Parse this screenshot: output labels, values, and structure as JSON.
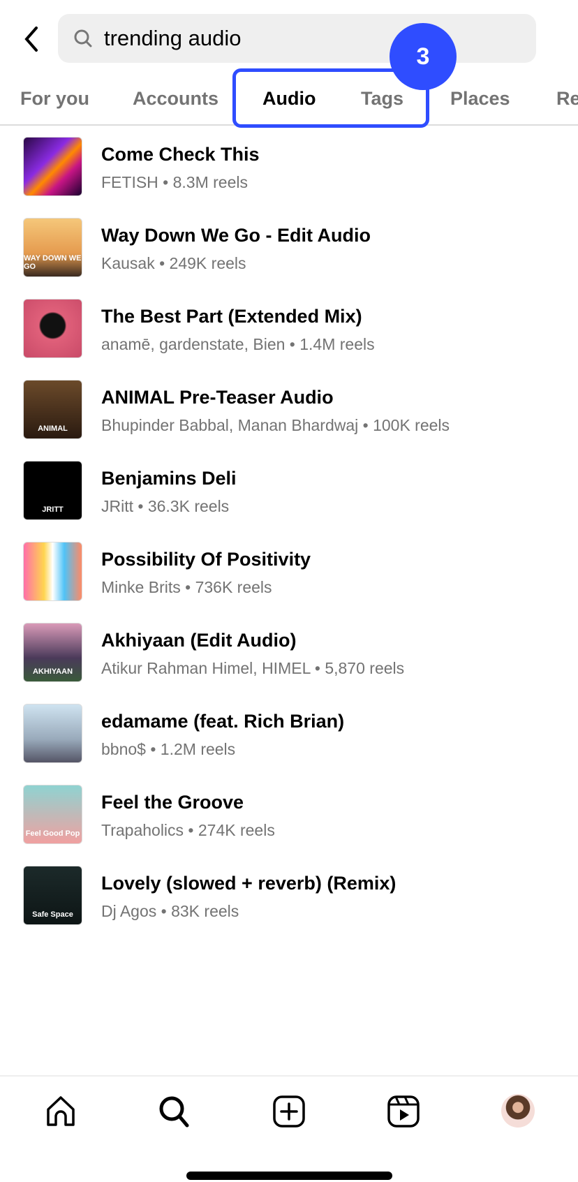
{
  "header": {
    "search_value": "trending audio"
  },
  "tabs": [
    "For you",
    "Accounts",
    "Audio",
    "Tags",
    "Places",
    "Re"
  ],
  "active_tab": "Audio",
  "annotation": {
    "badge": "3",
    "color": "#2f4dff"
  },
  "results": [
    {
      "title": "Come Check This",
      "subtitle": "FETISH • 8.3M reels",
      "thumb": "linear-gradient(135deg,#2a0845,#8a2be2 40%,#ff8a00 55%,#c71585 70%,#1a0030)"
    },
    {
      "title": "Way Down We Go - Edit Audio",
      "subtitle": "Kausak • 249K reels",
      "thumb": "linear-gradient(180deg,#f5c77a,#e59b4f 60%,#3a2a20)",
      "label": "WAY DOWN WE GO"
    },
    {
      "title": "The Best Part (Extended Mix)",
      "subtitle": "anamē, gardenstate, Bien • 1.4M reels",
      "thumb": "radial-gradient(circle at 50% 45%,#111 0 28%,#e0607a 32%,#c94a68)"
    },
    {
      "title": "ANIMAL Pre-Teaser Audio",
      "subtitle": "Bhupinder Babbal, Manan Bhardwaj • 100K reels",
      "thumb": "linear-gradient(180deg,#6b4a2a,#2a1a10)",
      "label": "ANIMAL"
    },
    {
      "title": "Benjamins Deli",
      "subtitle": "JRitt • 36.3K reels",
      "thumb": "#000",
      "label": "JRITT"
    },
    {
      "title": "Possibility Of Positivity",
      "subtitle": "Minke Brits • 736K reels",
      "thumb": "linear-gradient(90deg,#ff6fa8,#ffd54f 35%,#fff 50%,#4fc3f7 70%,#ff8a65)"
    },
    {
      "title": "Akhiyaan (Edit Audio)",
      "subtitle": "Atikur Rahman Himel, HIMEL • 5,870 reels",
      "thumb": "linear-gradient(180deg,#d99ab8,#4a3a5a 60%,#3a5a3a)",
      "label": "AKHIYAAN"
    },
    {
      "title": "edamame (feat. Rich Brian)",
      "subtitle": "bbno$ • 1.2M reels",
      "thumb": "linear-gradient(180deg,#cfe3f0,#9ab 60%,#556)"
    },
    {
      "title": "Feel the Groove",
      "subtitle": "Trapaholics • 274K reels",
      "thumb": "linear-gradient(180deg,#8fd3d1,#f0a0a0)",
      "label": "Feel Good Pop"
    },
    {
      "title": "Lovely (slowed + reverb) (Remix)",
      "subtitle": "Dj Agos • 83K reels",
      "thumb": "linear-gradient(180deg,#1c2a2a,#0d1515)",
      "label": "Safe Space"
    }
  ],
  "bottom_nav": [
    "home",
    "search",
    "create",
    "reels",
    "profile"
  ]
}
